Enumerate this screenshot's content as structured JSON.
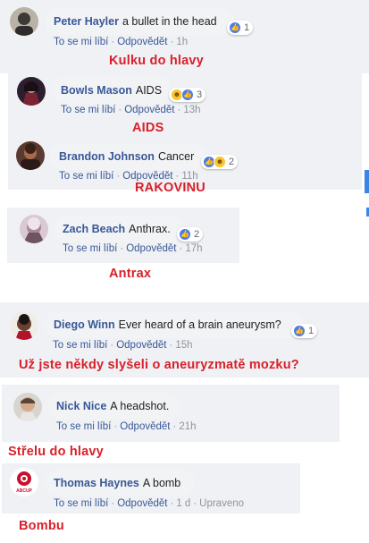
{
  "comments": [
    {
      "name": "Peter Hayler",
      "text": "a bullet in the head",
      "reactions": {
        "types": [
          "like"
        ],
        "count": "1"
      },
      "like": "To se mi líbí",
      "reply": "Odpovědět",
      "time": "1h",
      "translation": "Kulku do hlavy"
    },
    {
      "name": "Bowls Mason",
      "text": "AIDS",
      "reactions": {
        "types": [
          "haha",
          "like"
        ],
        "count": "3"
      },
      "like": "To se mi líbí",
      "reply": "Odpovědět",
      "time": "13h",
      "translation": "AIDS"
    },
    {
      "name": "Brandon Johnson",
      "text": "Cancer",
      "reactions": {
        "types": [
          "like",
          "haha"
        ],
        "count": "2"
      },
      "like": "To se mi líbí",
      "reply": "Odpovědět",
      "time": "11h",
      "translation": "RAKOVINU"
    },
    {
      "name": "Zach Beach",
      "text": "Anthrax.",
      "reactions": {
        "types": [
          "like"
        ],
        "count": "2"
      },
      "like": "To se mi líbí",
      "reply": "Odpovědět",
      "time": "17h",
      "translation": "Antrax"
    },
    {
      "name": "Diego Winn",
      "text": "Ever heard of a brain aneurysm?",
      "reactions": {
        "types": [
          "like"
        ],
        "count": "1"
      },
      "like": "To se mi líbí",
      "reply": "Odpovědět",
      "time": "15h",
      "translation": "Už jste někdy slyšeli o aneuryzmatě mozku?"
    },
    {
      "name": "Nick Nice",
      "text": "A headshot.",
      "like": "To se mi líbí",
      "reply": "Odpovědět",
      "time": "21h",
      "translation": "Střelu do hlavy"
    },
    {
      "name": "Thomas Haynes",
      "text": "A bomb",
      "like": "To se mi líbí",
      "reply": "Odpovědět",
      "time": "1 d",
      "edited": "Upraveno",
      "translation": "Bombu"
    }
  ],
  "avatar_labels": {
    "thomas": "ABCUP"
  },
  "colors": {
    "name": "#385898",
    "translation": "#d9202a",
    "bubble": "#f2f3f5",
    "panel": "#eff1f4",
    "like": "#4a7bee"
  }
}
